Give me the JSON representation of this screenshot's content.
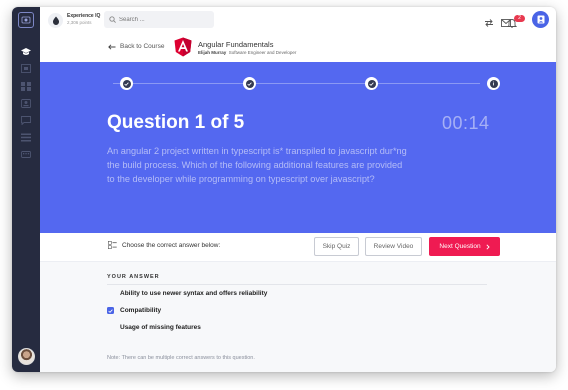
{
  "topbar": {
    "xp_title": "Experience IQ",
    "xp_points": "2,306 points",
    "search_placeholder": "Search ...",
    "notification_count": "2"
  },
  "course": {
    "back_label": "Back to Course",
    "title": "Angular Fundamentals",
    "author_name": "Elijah Murray",
    "author_role": "Software Engineer and Developer"
  },
  "question": {
    "title": "Question 1 of 5",
    "timer": "00:14",
    "text": "An angular 2 project written in typescript is* transpiled to javascript dur*ng the build process. Which of the following additional features are provided to the developer while programming on typescript over javascript?"
  },
  "progress": {
    "steps_total": 4,
    "current_step": 4
  },
  "answerbar": {
    "instruction": "Choose the correct answer below:",
    "skip_label": "Skip Quiz",
    "review_label": "Review Video",
    "next_label": "Next Question"
  },
  "answers": {
    "heading": "YOUR ANSWER",
    "options": [
      {
        "label": "Ability to use newer syntax and offers reliability",
        "checked": false
      },
      {
        "label": "Compatibility",
        "checked": true
      },
      {
        "label": "Usage of missing features",
        "checked": false
      }
    ],
    "note": "Note: There can be multiple correct answers to this question."
  },
  "colors": {
    "sidebar": "#262b40",
    "hero": "#5468f0",
    "accent": "#ef1b52",
    "checkbox": "#4a64e6"
  }
}
